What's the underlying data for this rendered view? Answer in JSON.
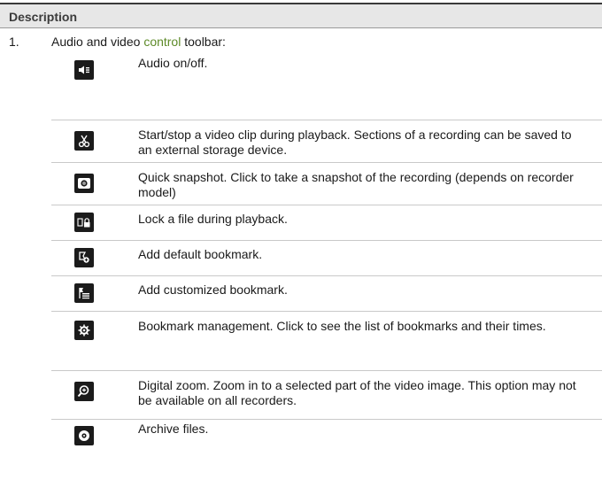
{
  "header": {
    "title": "Description"
  },
  "item": {
    "number": "1.",
    "intro_before": "Audio and video ",
    "intro_highlight": "control",
    "intro_after": " toolbar:"
  },
  "toolbar_items": [
    {
      "icon": "audio-icon",
      "text": "Audio on/off."
    },
    {
      "icon": "scissors-clip-icon",
      "text": "Start/stop a video clip during playback. Sections of a recording can be saved to an external storage device."
    },
    {
      "icon": "camera-snapshot-icon",
      "text": "Quick snapshot. Click to take a snapshot of the recording (depends on recorder model)"
    },
    {
      "icon": "lock-file-icon",
      "text": "Lock a file during playback."
    },
    {
      "icon": "default-bookmark-icon",
      "text": "Add default bookmark."
    },
    {
      "icon": "customized-bookmark-icon",
      "text": "Add customized bookmark."
    },
    {
      "icon": "bookmark-management-icon",
      "text": "Bookmark management. Click to see the list of bookmarks and their times."
    },
    {
      "icon": "digital-zoom-icon",
      "text": "Digital zoom. Zoom in to a selected part of the video image. This option may not be available on all recorders."
    },
    {
      "icon": "archive-files-icon",
      "text": "Archive files."
    }
  ],
  "colors": {
    "highlight": "#5d8a28",
    "icon_bg": "#1b1b1b",
    "header_bg": "#e7e7e7"
  }
}
